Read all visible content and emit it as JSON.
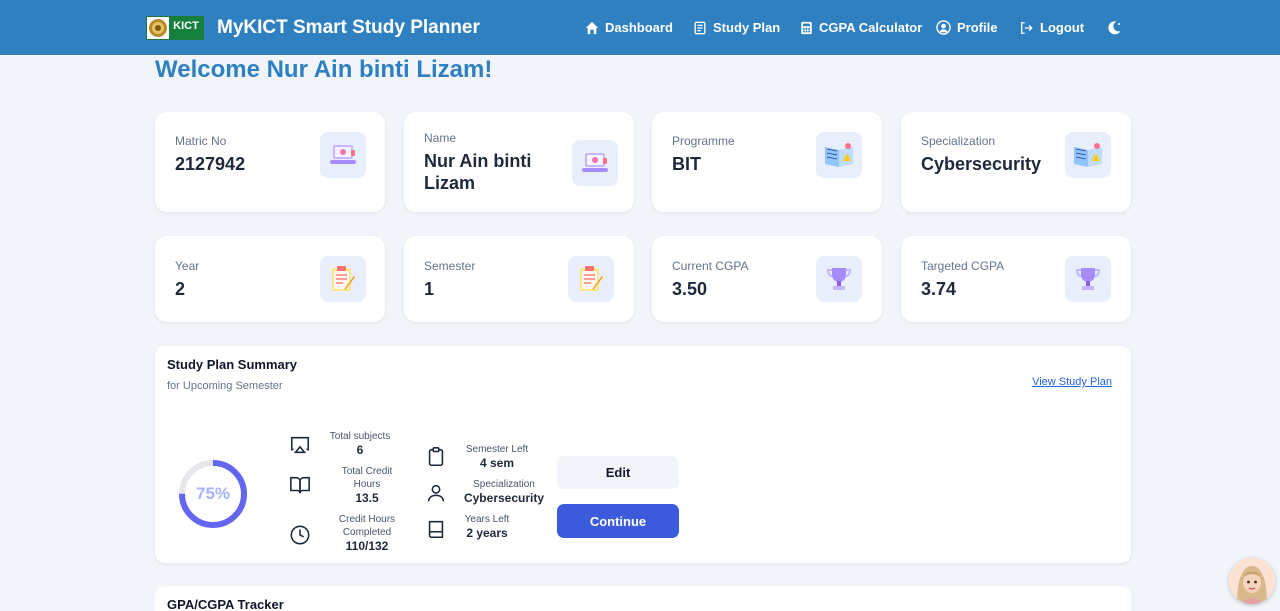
{
  "brand": {
    "logo_text": "KICT",
    "title": "MyKICT Smart Study Planner"
  },
  "nav": {
    "dashboard": "Dashboard",
    "study_plan": "Study Plan",
    "cgpa_calculator": "CGPA Calculator",
    "profile": "Profile",
    "logout": "Logout"
  },
  "welcome": "Welcome Nur Ain binti Lizam!",
  "cards": {
    "matric": {
      "label": "Matric No",
      "value": "2127942"
    },
    "name": {
      "label": "Name",
      "value": "Nur Ain binti Lizam"
    },
    "programme": {
      "label": "Programme",
      "value": "BIT"
    },
    "specialization": {
      "label": "Specialization",
      "value": "Cybersecurity"
    },
    "year": {
      "label": "Year",
      "value": "2"
    },
    "semester": {
      "label": "Semester",
      "value": "1"
    },
    "current_cgpa": {
      "label": "Current CGPA",
      "value": "3.50"
    },
    "targeted_cgpa": {
      "label": "Targeted CGPA",
      "value": "3.74"
    }
  },
  "summary": {
    "title": "Study Plan Summary",
    "subtitle": "for Upcoming Semester",
    "link": "View Study Plan",
    "progress": 75,
    "progress_text": "75%",
    "total_subjects_label": "Total subjects",
    "total_subjects_value": "6",
    "credit_hours_label": "Total Credit Hours",
    "credit_hours_value": "13.5",
    "completed_label": "Credit Hours Completed",
    "completed_value": "110/132",
    "semester_left_label": "Semester Left",
    "semester_left_value": "4 sem",
    "specialization_label": "Specialization",
    "specialization_value": "Cybersecurity",
    "years_left_label": "Years Left",
    "years_left_value": "2 years",
    "edit": "Edit",
    "continue": "Continue"
  },
  "gpa_tracker": {
    "title": "GPA/CGPA Tracker"
  },
  "colors": {
    "navbar": "#2f80c1",
    "accent": "#3b5bdb",
    "progress_ring": "#6366f1"
  }
}
